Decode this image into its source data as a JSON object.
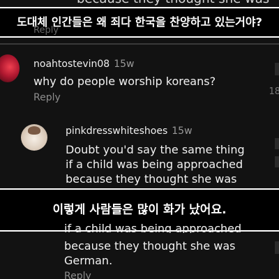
{
  "captions": {
    "top": "도대체 인간들은 왜 죄다 한국을 찬양하고 있는거야?",
    "middle": "이렇게 사람들은 많이 화가 났어요."
  },
  "clipped_text_top": "because they thought she was",
  "faded_reply": "Reply",
  "comments": [
    {
      "username": "noahtostevin08",
      "age": "15w",
      "text": "why do people worship koreans?",
      "reply": "Reply",
      "side_count": "18"
    },
    {
      "username": "pinkdresswhiteshoes",
      "age": "15w",
      "text_lines": [
        "Doubt you'd say the same thing",
        "if a child was being approached",
        "because they thought she was"
      ]
    }
  ],
  "repeated_text": {
    "partial_line": "if a child was being approached",
    "lines": [
      "because they thought she was",
      "German."
    ],
    "reply": "Reply"
  }
}
